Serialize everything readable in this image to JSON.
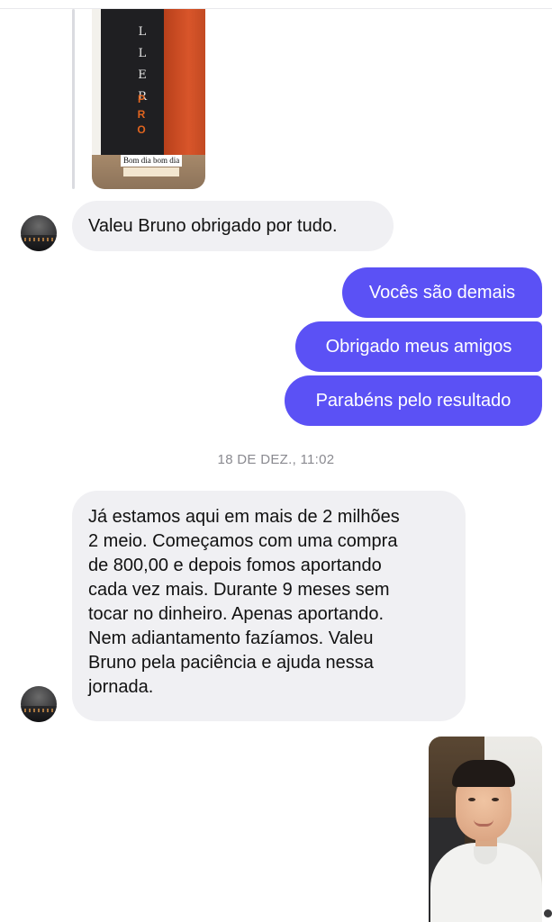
{
  "conversation": {
    "shared_story": {
      "overlay_text": "Bom dia bom dia",
      "sign_letters_top": "L L E R",
      "sign_letters_bottom": "P R O"
    },
    "messages": [
      {
        "id": "m1",
        "direction": "incoming",
        "text": "Valeu Bruno obrigado por tudo."
      },
      {
        "id": "m2",
        "direction": "outgoing",
        "text": "Vocês são demais"
      },
      {
        "id": "m3",
        "direction": "outgoing",
        "text": "Obrigado meus amigos"
      },
      {
        "id": "m4",
        "direction": "outgoing",
        "text": "Parabéns pelo resultado"
      },
      {
        "id": "m5",
        "direction": "incoming",
        "text": "Já estamos aqui em mais de 2 milhões\n2 meio. Começamos com uma compra\nde 800,00 e depois fomos aportando\ncada vez mais. Durante 9 meses sem\ntocar no dinheiro. Apenas aportando.\nNem adiantamento fazíamos.  Valeu\nBruno pela paciência e ajuda nessa\njornada."
      }
    ],
    "timestamp": "18 DE DEZ., 11:02"
  },
  "colors": {
    "outgoing_bubble": "#5b51f5",
    "incoming_bubble": "#f0f0f3",
    "timestamp_text": "#8a8a90"
  }
}
